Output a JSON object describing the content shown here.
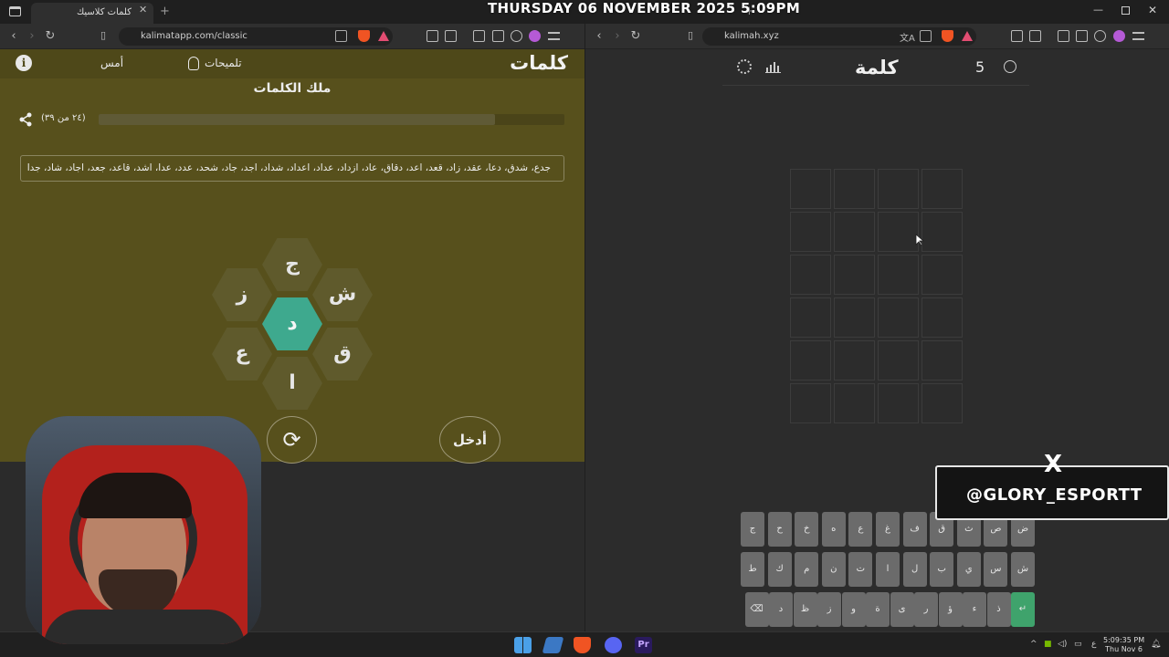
{
  "overlay": {
    "date_text": "THURSDAY 06 NOVEMBER 2025 5:09PM"
  },
  "left_browser": {
    "tab_title": "كلمات كلاسيك",
    "url": "kalimatapp.com/classic"
  },
  "left_app": {
    "title": "كلمات",
    "hints_label": "تلميحات",
    "yesterday_label": "أمس",
    "rank_title": "ملك الكلمات",
    "progress_text": "(٢٤ من ٣٩)",
    "progress_fraction": 0.85,
    "found_words": "جدع، شدق، دعا، عقد، زاد، قعد، اعد، دقاق، عاد، ازداد، عداد، اعداد، شداد، اجد، جاد، شحد، عدد، عدا، اشد، قاعد، جعد، اجاد، شاد، جدا",
    "letters": {
      "top": "ج",
      "upper_left": "ز",
      "upper_right": "ش",
      "center": "د",
      "lower_left": "ع",
      "lower_right": "ق",
      "bottom": "ا"
    },
    "enter_label": "أدخل",
    "shuffle_icon": "refresh-icon"
  },
  "right_browser": {
    "url": "kalimah.xyz"
  },
  "right_app": {
    "title": "كلمة",
    "streak": "5",
    "keyboard": {
      "row1": [
        "ض",
        "ص",
        "ث",
        "ق",
        "ف",
        "غ",
        "ع",
        "ه",
        "خ",
        "ح",
        "ج"
      ],
      "row2": [
        "ش",
        "س",
        "ي",
        "ب",
        "ل",
        "ا",
        "ت",
        "ن",
        "م",
        "ك",
        "ط"
      ],
      "row3": [
        "↵",
        "ذ",
        "ء",
        "ؤ",
        "ر",
        "ى",
        "ة",
        "و",
        "ز",
        "ظ",
        "د",
        "⌫"
      ]
    }
  },
  "social": {
    "handle": "@GLORY_ESPORTT",
    "network_glyph": "X"
  },
  "taskbar": {
    "time": "5:09:35 PM",
    "date": "Thu Nov 6",
    "lang": "ع"
  },
  "colors": {
    "left_bg": "#57501c",
    "hex_center": "#3ea98e",
    "enter_key": "#3fa36c"
  }
}
